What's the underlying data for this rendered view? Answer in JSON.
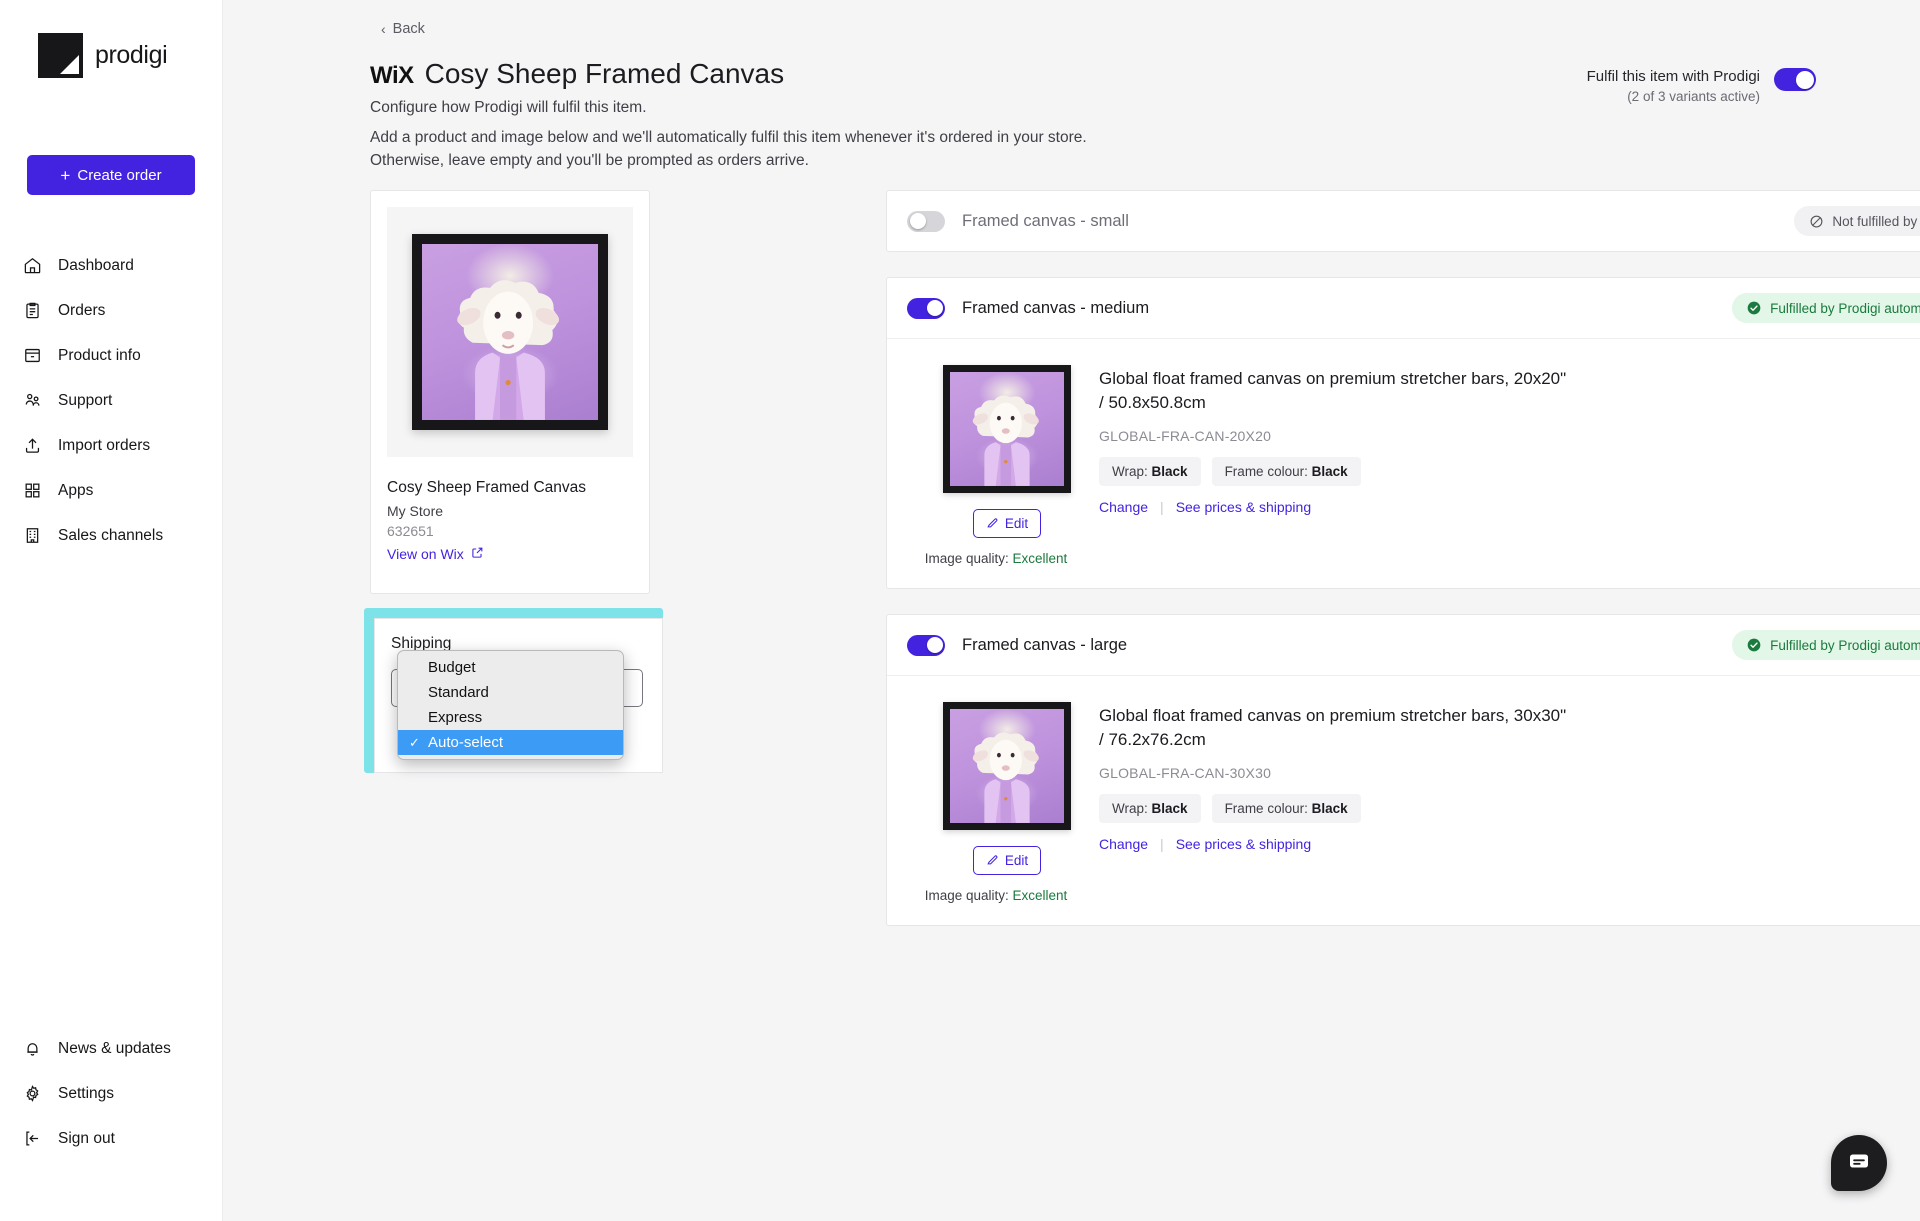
{
  "brand": {
    "name": "prodigi"
  },
  "sidebar": {
    "create_order_label": "Create order",
    "items": [
      {
        "label": "Dashboard",
        "icon": "home-icon"
      },
      {
        "label": "Orders",
        "icon": "clipboard-icon"
      },
      {
        "label": "Product info",
        "icon": "archive-icon"
      },
      {
        "label": "Support",
        "icon": "people-icon"
      },
      {
        "label": "Import orders",
        "icon": "upload-icon"
      },
      {
        "label": "Apps",
        "icon": "grid-icon"
      },
      {
        "label": "Sales channels",
        "icon": "building-icon"
      }
    ],
    "bottom_items": [
      {
        "label": "News & updates",
        "icon": "bell-icon"
      },
      {
        "label": "Settings",
        "icon": "gear-icon"
      },
      {
        "label": "Sign out",
        "icon": "sign-out-icon"
      }
    ]
  },
  "header": {
    "back_label": "Back",
    "channel_logo": "WiX",
    "title": "Cosy Sheep Framed Canvas",
    "subtitle": "Configure how Prodigi will fulfil this item.",
    "description_line1": "Add a product and image below and we'll automatically fulfil this item whenever it's ordered in your store.",
    "description_line2": "Otherwise, leave empty and you'll be prompted as orders arrive.",
    "fulfil_label": "Fulfil this item with Prodigi",
    "fulfil_sub": "(2 of 3 variants active)",
    "fulfil_on": true
  },
  "product": {
    "name": "Cosy Sheep Framed Canvas",
    "store": "My Store",
    "id": "632651",
    "view_link": "View on Wix"
  },
  "shipping": {
    "heading": "Shipping",
    "selected": "Auto-select",
    "options": [
      "Budget",
      "Standard",
      "Express",
      "Auto-select"
    ]
  },
  "variants": [
    {
      "title": "Framed canvas - small",
      "enabled": false,
      "status": "Not fulfilled by Prodigi",
      "status_type": "grey"
    },
    {
      "title": "Framed canvas - medium",
      "enabled": true,
      "status": "Fulfilled by Prodigi automatically",
      "status_type": "green",
      "item": {
        "name": "Global float framed canvas on premium stretcher bars, 20x20\" / 50.8x50.8cm",
        "sku": "GLOBAL-FRA-CAN-20X20",
        "attr_wrap_label": "Wrap:",
        "attr_wrap_value": "Black",
        "attr_frame_label": "Frame colour:",
        "attr_frame_value": "Black",
        "change_label": "Change",
        "prices_label": "See prices & shipping",
        "edit_label": "Edit",
        "quality_label": "Image quality:",
        "quality_value": "Excellent",
        "menu_label": "•••"
      }
    },
    {
      "title": "Framed canvas - large",
      "enabled": true,
      "status": "Fulfilled by Prodigi automatically",
      "status_type": "green",
      "item": {
        "name": "Global float framed canvas on premium stretcher bars, 30x30\" / 76.2x76.2cm",
        "sku": "GLOBAL-FRA-CAN-30X30",
        "attr_wrap_label": "Wrap:",
        "attr_wrap_value": "Black",
        "attr_frame_label": "Frame colour:",
        "attr_frame_value": "Black",
        "change_label": "Change",
        "prices_label": "See prices & shipping",
        "edit_label": "Edit",
        "quality_label": "Image quality:",
        "quality_value": "Excellent",
        "menu_label": "•••"
      }
    }
  ],
  "colors": {
    "accent": "#4423e0",
    "success": "#1b7a3d",
    "success_bg": "#e2f7e8",
    "highlight": "#7ee3e8",
    "dropdown_selected": "#3b9bf5"
  }
}
